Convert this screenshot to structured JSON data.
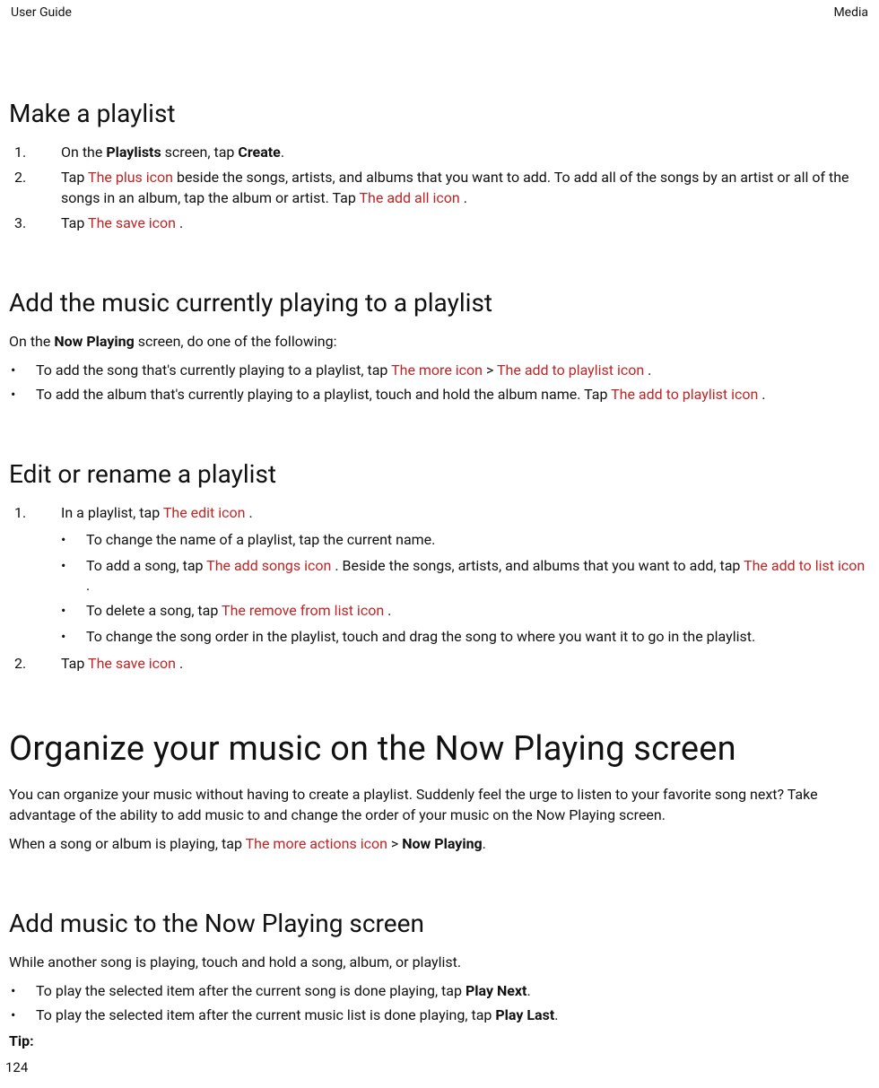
{
  "header": {
    "left": "User Guide",
    "right": "Media"
  },
  "page_number": "124",
  "sections": {
    "make_playlist": {
      "heading": "Make a playlist",
      "step1_a": "On the ",
      "step1_b_screen": "Playlists",
      "step1_c": " screen, tap ",
      "step1_d_action": "Create",
      "step1_e": ".",
      "step2_a": "Tap ",
      "step2_icon1": " The plus icon ",
      "step2_b": " beside the songs, artists, and albums that you want to add. To add all of the songs by an artist or all of the songs in an album, tap the album or artist. Tap ",
      "step2_icon2": " The add all icon ",
      "step2_c": ".",
      "step3_a": "Tap ",
      "step3_icon": " The save icon ",
      "step3_b": "."
    },
    "add_current": {
      "heading": "Add the music currently playing to a playlist",
      "intro_a": "On the ",
      "intro_b_screen": "Now Playing",
      "intro_c": " screen, do one of the following:",
      "b1_a": "To add the song that's currently playing to a playlist, tap ",
      "b1_icon1": " The more icon ",
      "b1_b": " > ",
      "b1_icon2": " The add to playlist icon ",
      "b1_c": ".",
      "b2_a": "To add the album that's currently playing to a playlist, touch and hold the album name. Tap ",
      "b2_icon": " The add to playlist icon ",
      "b2_b": "."
    },
    "edit_rename": {
      "heading": "Edit or rename a playlist",
      "s1_a": "In a playlist, tap ",
      "s1_icon": " The edit icon ",
      "s1_b": ".",
      "sub1": "To change the name of a playlist, tap the current name.",
      "sub2_a": "To add a song, tap ",
      "sub2_icon1": " The add songs icon ",
      "sub2_b": ". Beside the songs, artists, and albums that you want to add, tap ",
      "sub2_icon2": " The add to list icon ",
      "sub2_c": ".",
      "sub3_a": "To delete a song, tap ",
      "sub3_icon": " The remove from list icon ",
      "sub3_b": ".",
      "sub4": "To change the song order in the playlist, touch and drag the song to where you want it to go in the playlist.",
      "s2_a": "Tap ",
      "s2_icon": " The save icon ",
      "s2_b": "."
    },
    "organize": {
      "heading": "Organize your music on the Now Playing screen",
      "p1": "You can organize your music without having to create a playlist. Suddenly feel the urge to listen to your favorite song next? Take advantage of the ability to add music to and change the order of your music on the Now Playing screen.",
      "p2_a": "When a song or album is playing, tap ",
      "p2_icon": " The more actions icon ",
      "p2_b": " > ",
      "p2_bold": "Now Playing",
      "p2_c": "."
    },
    "add_music_np": {
      "heading": "Add music to the Now Playing screen",
      "p1": "While another song is playing, touch and hold a song, album, or playlist.",
      "b1_a": "To play the selected item after the current song is done playing, tap ",
      "b1_bold": "Play Next",
      "b1_b": ".",
      "b2_a": "To play the selected item after the current music list is done playing, tap ",
      "b2_bold": "Play Last",
      "b2_b": ".",
      "tip_label": "Tip:"
    }
  }
}
